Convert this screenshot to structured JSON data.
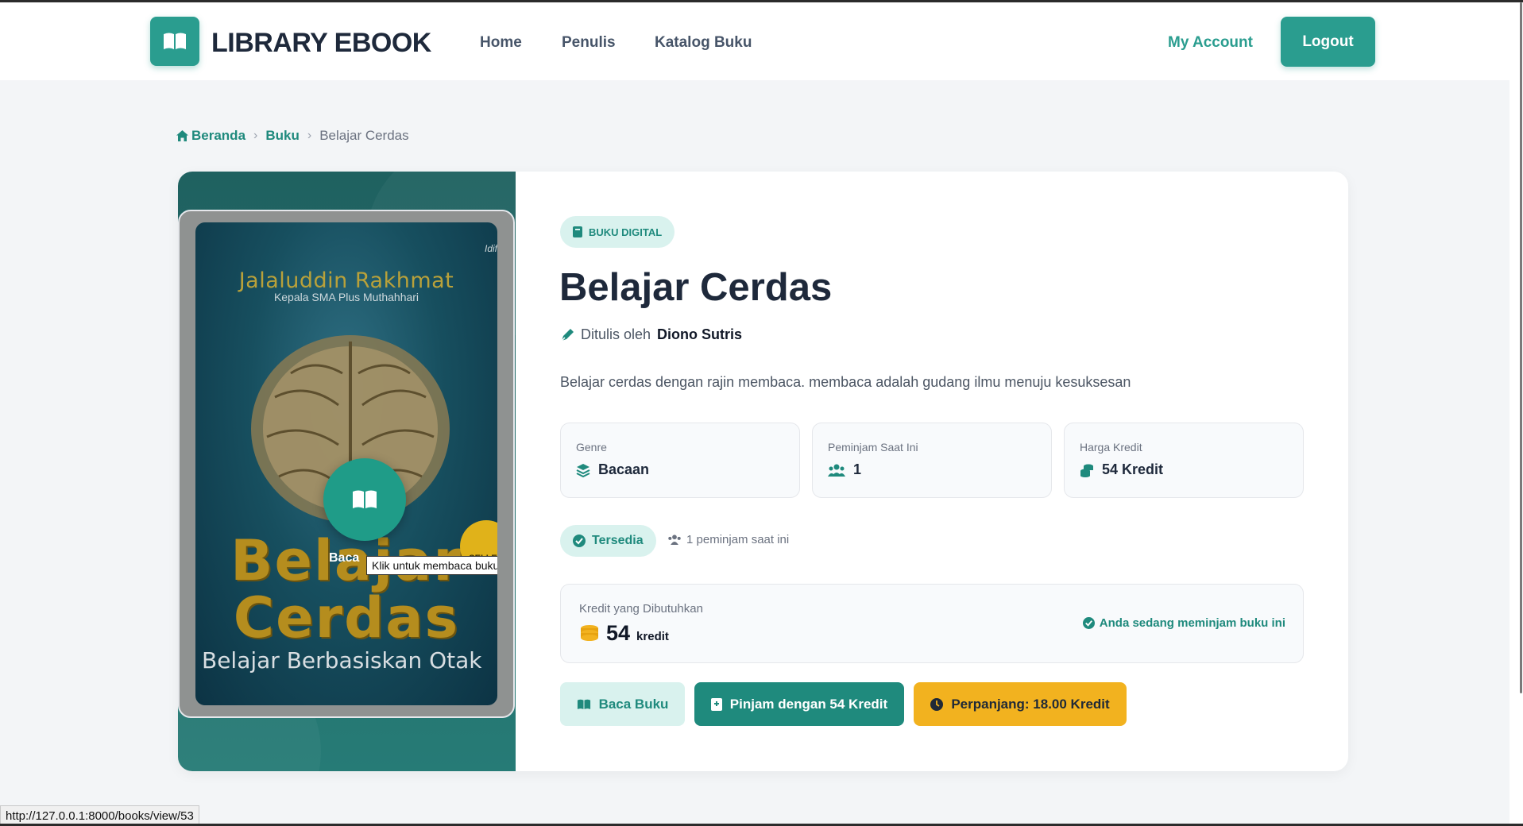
{
  "navbar": {
    "brand": "LIBRARY EBOOK",
    "links": [
      "Home",
      "Penulis",
      "Katalog Buku"
    ],
    "my_account": "My Account",
    "logout": "Logout"
  },
  "breadcrumb": {
    "home": "Beranda",
    "section": "Buku",
    "current": "Belajar Cerdas"
  },
  "cover": {
    "author": "Jalaluddin Rakhmat",
    "author_subtitle": "Kepala SMA Plus Muthahhari",
    "publisher": "Idif",
    "title_line1": "Belajar",
    "title_line2": "Cerdas",
    "tagline": "Belajar Berbasiskan Otak",
    "badge": "SELLER",
    "read_caption": "Baca",
    "tooltip": "Klik untuk membaca buku"
  },
  "book": {
    "badge": "BUKU DIGITAL",
    "title": "Belajar Cerdas",
    "written_by": "Ditulis oleh",
    "author": "Diono Sutris",
    "description": "Belajar cerdas dengan rajin membaca. membaca adalah gudang ilmu menuju kesuksesan"
  },
  "info": {
    "genre_label": "Genre",
    "genre_value": "Bacaan",
    "borrowers_label": "Peminjam Saat Ini",
    "borrowers_value": "1",
    "price_label": "Harga Kredit",
    "price_value": "54 Kredit"
  },
  "status": {
    "availability": "Tersedia",
    "borrowers_note": "1 peminjam saat ini"
  },
  "credit": {
    "label": "Kredit yang Dibutuhkan",
    "value": "54",
    "unit": "kredit",
    "borrowing_note": "Anda sedang meminjam buku ini"
  },
  "actions": {
    "read": "Baca Buku",
    "borrow": "Pinjam dengan 54 Kredit",
    "extend": "Perpanjang: 18.00 Kredit"
  },
  "status_bar": {
    "url": "http://127.0.0.1:8000/books/view/53"
  },
  "colors": {
    "accent": "#2a9d8f",
    "accent_dark": "#1f8a7d",
    "accent_light": "#d9f2ee",
    "warning": "#f2b21f"
  }
}
